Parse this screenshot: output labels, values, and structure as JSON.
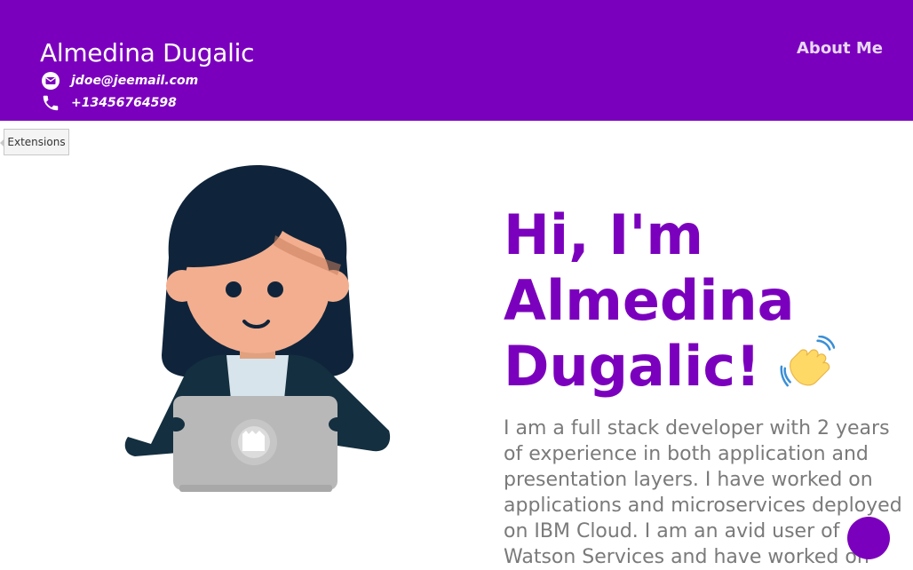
{
  "header": {
    "name": "Almedina Dugalic",
    "email": "jdoe@jeemail.com",
    "phone": "+13456764598",
    "email_icon": "email-icon",
    "phone_icon": "phone-icon",
    "background_color": "#7b00bd"
  },
  "nav": {
    "about": "About Me"
  },
  "extensions": {
    "label": "Extensions"
  },
  "hero": {
    "title": "Hi, I'm Almedina Dugalic!",
    "wave_icon": "waving-hand-icon",
    "description": "I am a full stack developer with 2 years of experience in both application and presentation layers. I have worked on applications and microservices deployed on IBM Cloud. I am an avid user of Watson Services and have worked on",
    "title_color": "#7b00bd",
    "text_color": "#7a7a7a"
  },
  "fab": {
    "color": "#7b00bd"
  }
}
